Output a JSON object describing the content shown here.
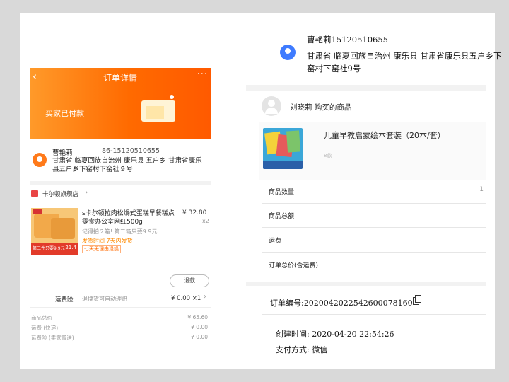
{
  "left": {
    "header": {
      "back_icon": "‹",
      "title": "订单详情",
      "more_icon": "···",
      "status": "买家已付款"
    },
    "address": {
      "name": "曹艳莉",
      "phone": "86-15120510655",
      "detail": "甘肃省 临夏回族自治州 康乐县 五户乡 甘肃省康乐县五户乡下窑村下窑社９号"
    },
    "shop": {
      "name": "卡尔顿旗舰店",
      "chevron": "›"
    },
    "product": {
      "title": "s卡尔顿拉肉松焗式蛋糕早餐糕点零食办公室网红500g",
      "price": "¥ 32.80",
      "qty": "x2",
      "promo": "记得拍２箱! 第二箱只要9.9元",
      "ship_time": "发货时间 7天内发货",
      "tag": "七天无理由退换",
      "image_banner": "第二件只要9.9元",
      "image_price": "21.4"
    },
    "refund_label": "退款",
    "insurance": {
      "label": "运费险",
      "desc": "退换货可自动理赔",
      "value": "¥ 0.00 ×1",
      "chevron": "›"
    },
    "summary": [
      {
        "key": "商品总价",
        "value": "¥ 65.60"
      },
      {
        "key": "运费 (快递)",
        "value": "¥ 0.00"
      },
      {
        "key": "运费险 (卖家赠送)",
        "value": "¥ 0.00"
      }
    ]
  },
  "right": {
    "receiver": "曹艳莉15120510655",
    "address": "甘肃省 临夏回族自治州 康乐县 甘肃省康乐县五户乡下窑村下窑社9号",
    "buyer_title": "刘晓莉 购买的商品",
    "product_title": "儿童早教启蒙绘本套装（20本/套）",
    "product_sku": "8款",
    "rows": [
      "商品数量",
      "商品总额",
      "运费",
      "订单总价(含运费)"
    ],
    "row_edge": "1",
    "order_no": "订单编号:20200420225426000781​60",
    "created": "创建时间: 2020-04-20 22:54:26",
    "payment": "支付方式: 微信"
  }
}
